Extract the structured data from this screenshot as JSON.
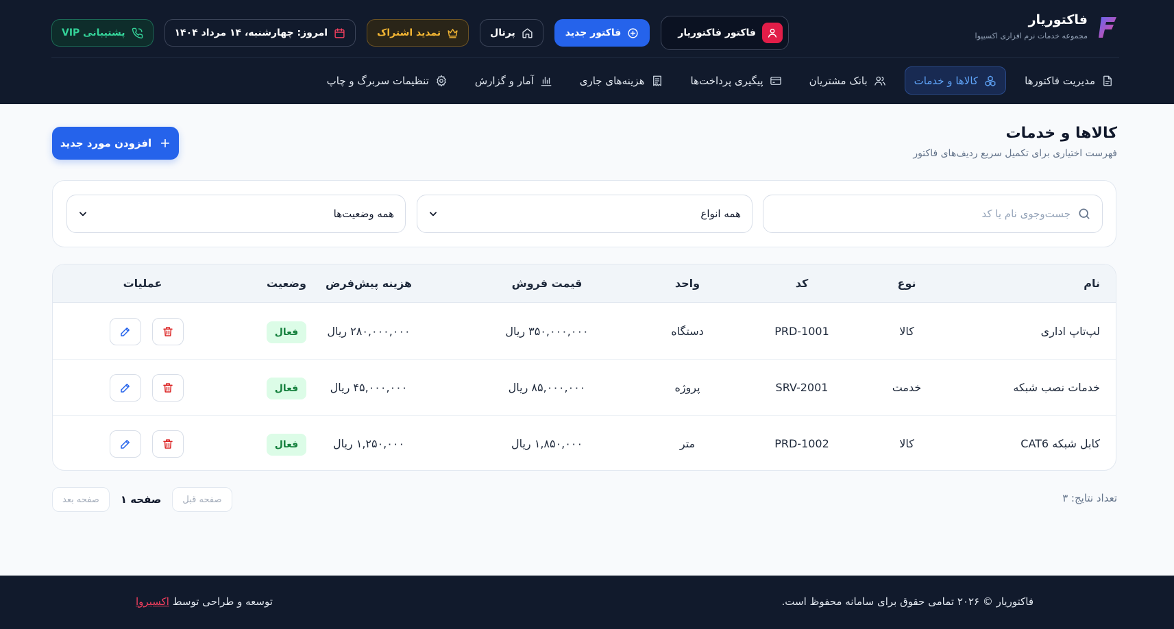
{
  "brand": {
    "name": "فاکتوریار",
    "subtitle": "مجموعه خدمات نرم افزاری اکسیپوا"
  },
  "header_buttons": {
    "support": "پشتیبانی VIP",
    "date": "امروز: چهارشنبه، ۱۴ مرداد ۱۴۰۴",
    "renew": "تمدید اشتراک",
    "portal": "پرتال",
    "new_invoice": "فاکتور جدید",
    "user": "فاکتور فاکتوریار"
  },
  "nav": [
    {
      "label": "مدیریت فاکتورها",
      "icon": "document-icon",
      "active": false
    },
    {
      "label": "کالاها و خدمات",
      "icon": "boxes-icon",
      "active": true
    },
    {
      "label": "بانک مشتریان",
      "icon": "users-icon",
      "active": false
    },
    {
      "label": "پیگیری پرداخت‌ها",
      "icon": "credit-card-icon",
      "active": false
    },
    {
      "label": "هزینه‌های جاری",
      "icon": "receipt-icon",
      "active": false
    },
    {
      "label": "آمار و گزارش",
      "icon": "bar-chart-icon",
      "active": false
    },
    {
      "label": "تنظیمات سربرگ و چاپ",
      "icon": "gear-icon",
      "active": false
    }
  ],
  "page": {
    "title": "کالاها و خدمات",
    "subtitle": "فهرست اختیاری برای تکمیل سریع ردیف‌های فاکتور",
    "add_button": "افزودن مورد جدید"
  },
  "filters": {
    "search_placeholder": "جست‌وجوی نام یا کد",
    "type_selected": "همه انواع",
    "status_selected": "همه وضعیت‌ها"
  },
  "table": {
    "headers": {
      "name": "نام",
      "type": "نوع",
      "code": "کد",
      "unit": "واحد",
      "price": "قیمت فروش",
      "cost": "هزینه پیش‌فرض",
      "status": "وضعیت",
      "ops": "عملیات"
    },
    "rows": [
      {
        "name": "لپ‌تاپ اداری",
        "type": "کالا",
        "code": "PRD-1001",
        "unit": "دستگاه",
        "price": "۳۵۰,۰۰۰,۰۰۰ ریال",
        "cost": "۲۸۰,۰۰۰,۰۰۰ ریال",
        "status": "فعال"
      },
      {
        "name": "خدمات نصب شبکه",
        "type": "خدمت",
        "code": "SRV-2001",
        "unit": "پروژه",
        "price": "۸۵,۰۰۰,۰۰۰ ریال",
        "cost": "۴۵,۰۰۰,۰۰۰ ریال",
        "status": "فعال"
      },
      {
        "name": "کابل شبکه CAT6",
        "type": "کالا",
        "code": "PRD-1002",
        "unit": "متر",
        "price": "۱,۸۵۰,۰۰۰ ریال",
        "cost": "۱,۲۵۰,۰۰۰ ریال",
        "status": "فعال"
      }
    ]
  },
  "pagination": {
    "count": "تعداد نتایج: ۳",
    "prev": "صفحه قبل",
    "current": "صفحه ۱",
    "next": "صفحه بعد"
  },
  "footer": {
    "copyright": "فاکتوریار © ۲۰۲۶ تمامی حقوق برای سامانه محفوظ است.",
    "credit_prefix": "توسعه و طراحی توسط",
    "credit_link": "اکسیروا"
  },
  "colors": {
    "header_bg": "#111a2c",
    "primary": "#2563eb",
    "active_nav": "#60a5fa",
    "support": "#34d399",
    "renew": "#f2b533",
    "avatar": "#e11d48",
    "status_active_bg": "#dcfce7",
    "status_active_text": "#15803d",
    "delete": "#dc2626"
  }
}
